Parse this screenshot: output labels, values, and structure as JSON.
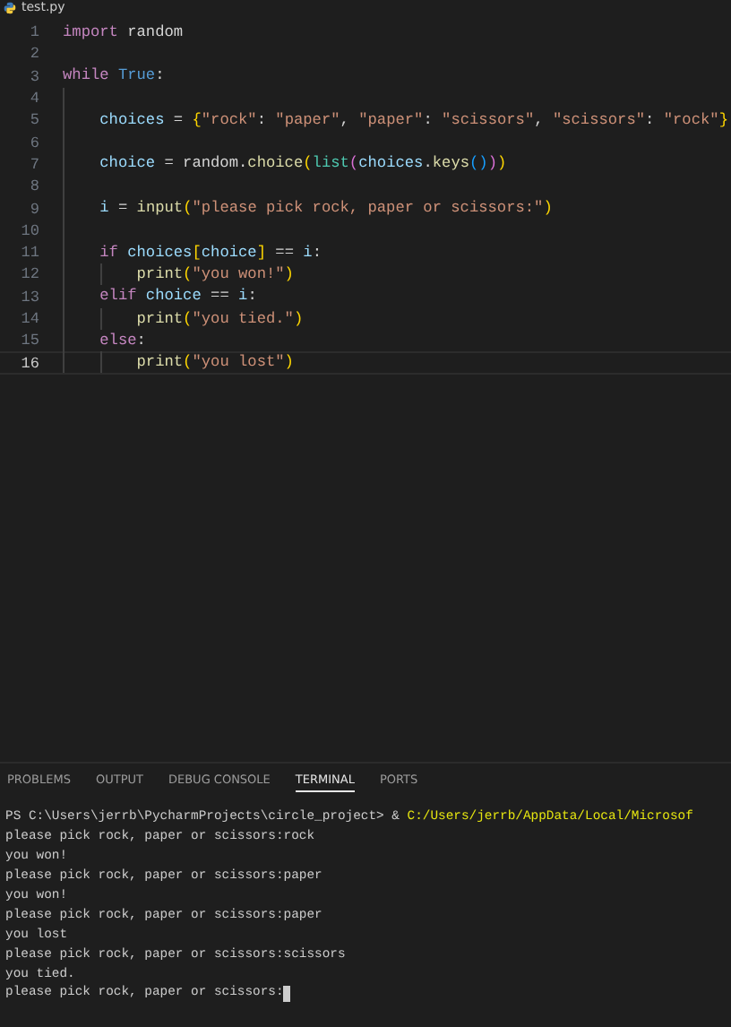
{
  "editor_tab": {
    "title": "test.py"
  },
  "code_lines": [
    {
      "number": "1",
      "kind": "code",
      "current": false,
      "tokens": [
        {
          "kind": "keyword",
          "text": "import"
        },
        {
          "kind": "plain",
          "text": " random"
        }
      ]
    },
    {
      "number": "2",
      "kind": "blank",
      "current": false
    },
    {
      "number": "3",
      "kind": "code",
      "current": false,
      "tokens": [
        {
          "kind": "keyword",
          "text": "while "
        },
        {
          "kind": "const",
          "text": "True"
        },
        {
          "kind": "plain",
          "text": ":"
        }
      ]
    },
    {
      "number": "4",
      "kind": "blank_indented",
      "current": false
    },
    {
      "number": "5",
      "kind": "code",
      "current": false,
      "tokens": [
        {
          "kind": "var",
          "text": "    choices"
        },
        {
          "kind": "plain",
          "text": " = "
        },
        {
          "kind": "bracket1",
          "text": "{"
        },
        {
          "kind": "string",
          "text": "\"rock\""
        },
        {
          "kind": "plain",
          "text": ": "
        },
        {
          "kind": "string",
          "text": "\"paper\""
        },
        {
          "kind": "plain",
          "text": ", "
        },
        {
          "kind": "string",
          "text": "\"paper\""
        },
        {
          "kind": "plain",
          "text": ": "
        },
        {
          "kind": "string",
          "text": "\"scissors\""
        },
        {
          "kind": "plain",
          "text": ", "
        },
        {
          "kind": "string",
          "text": "\"scissors\""
        },
        {
          "kind": "plain",
          "text": ": "
        },
        {
          "kind": "string",
          "text": "\"rock\""
        },
        {
          "kind": "bracket1",
          "text": "}"
        }
      ]
    },
    {
      "number": "6",
      "kind": "blank_indented",
      "current": false
    },
    {
      "number": "7",
      "kind": "code",
      "current": false,
      "tokens": [
        {
          "kind": "var",
          "text": "    choice"
        },
        {
          "kind": "plain",
          "text": " = random."
        },
        {
          "kind": "func",
          "text": "choice"
        },
        {
          "kind": "bracket1",
          "text": "("
        },
        {
          "kind": "type",
          "text": "list"
        },
        {
          "kind": "bracket2",
          "text": "("
        },
        {
          "kind": "var",
          "text": "choices"
        },
        {
          "kind": "plain",
          "text": "."
        },
        {
          "kind": "func",
          "text": "keys"
        },
        {
          "kind": "bracket3",
          "text": "()"
        },
        {
          "kind": "bracket2",
          "text": ")"
        },
        {
          "kind": "bracket1",
          "text": ")"
        }
      ]
    },
    {
      "number": "8",
      "kind": "blank_indented",
      "current": false
    },
    {
      "number": "9",
      "kind": "code",
      "current": false,
      "tokens": [
        {
          "kind": "var",
          "text": "    i"
        },
        {
          "kind": "plain",
          "text": " = "
        },
        {
          "kind": "func",
          "text": "input"
        },
        {
          "kind": "bracket1",
          "text": "("
        },
        {
          "kind": "string",
          "text": "\"please pick rock, paper or scissors:\""
        },
        {
          "kind": "bracket1",
          "text": ")"
        }
      ]
    },
    {
      "number": "10",
      "kind": "blank_indented",
      "current": false
    },
    {
      "number": "11",
      "kind": "code",
      "current": false,
      "tokens": [
        {
          "kind": "keyword",
          "text": "    if "
        },
        {
          "kind": "var",
          "text": "choices"
        },
        {
          "kind": "bracket1",
          "text": "["
        },
        {
          "kind": "var",
          "text": "choice"
        },
        {
          "kind": "bracket1",
          "text": "]"
        },
        {
          "kind": "plain",
          "text": " == "
        },
        {
          "kind": "var",
          "text": "i"
        },
        {
          "kind": "plain",
          "text": ":"
        }
      ]
    },
    {
      "number": "12",
      "kind": "code",
      "current": false,
      "tokens": [
        {
          "kind": "func",
          "text": "        print"
        },
        {
          "kind": "bracket1",
          "text": "("
        },
        {
          "kind": "string",
          "text": "\"you won!\""
        },
        {
          "kind": "bracket1",
          "text": ")"
        }
      ]
    },
    {
      "number": "13",
      "kind": "code",
      "current": false,
      "tokens": [
        {
          "kind": "keyword",
          "text": "    elif "
        },
        {
          "kind": "var",
          "text": "choice"
        },
        {
          "kind": "plain",
          "text": " == "
        },
        {
          "kind": "var",
          "text": "i"
        },
        {
          "kind": "plain",
          "text": ":"
        }
      ]
    },
    {
      "number": "14",
      "kind": "code",
      "current": false,
      "tokens": [
        {
          "kind": "func",
          "text": "        print"
        },
        {
          "kind": "bracket1",
          "text": "("
        },
        {
          "kind": "string",
          "text": "\"you tied.\""
        },
        {
          "kind": "bracket1",
          "text": ")"
        }
      ]
    },
    {
      "number": "15",
      "kind": "code",
      "current": false,
      "tokens": [
        {
          "kind": "keyword",
          "text": "    else"
        },
        {
          "kind": "plain",
          "text": ":"
        }
      ]
    },
    {
      "number": "16",
      "kind": "code",
      "current": true,
      "tokens": [
        {
          "kind": "func",
          "text": "        print"
        },
        {
          "kind": "bracket1",
          "text": "("
        },
        {
          "kind": "string",
          "text": "\"you lost\""
        },
        {
          "kind": "bracket1",
          "text": ")"
        }
      ]
    }
  ],
  "panel_tabs": [
    {
      "label": "PROBLEMS",
      "selected": false
    },
    {
      "label": "OUTPUT",
      "selected": false
    },
    {
      "label": "DEBUG CONSOLE",
      "selected": false
    },
    {
      "label": "TERMINAL",
      "selected": true
    },
    {
      "label": "PORTS",
      "selected": false
    }
  ],
  "terminal_lines": [
    {
      "cursor": false,
      "segments": [
        {
          "kind": "plain",
          "text": "PS C:\\Users\\jerrb\\PycharmProjects\\circle_project> & "
        },
        {
          "kind": "path",
          "text": "C:/Users/jerrb/AppData/Local/Microsof"
        }
      ]
    },
    {
      "cursor": false,
      "segments": [
        {
          "kind": "plain",
          "text": "please pick rock, paper or scissors:rock"
        }
      ]
    },
    {
      "cursor": false,
      "segments": [
        {
          "kind": "plain",
          "text": "you won!"
        }
      ]
    },
    {
      "cursor": false,
      "segments": [
        {
          "kind": "plain",
          "text": "please pick rock, paper or scissors:paper"
        }
      ]
    },
    {
      "cursor": false,
      "segments": [
        {
          "kind": "plain",
          "text": "you won!"
        }
      ]
    },
    {
      "cursor": false,
      "segments": [
        {
          "kind": "plain",
          "text": "please pick rock, paper or scissors:paper"
        }
      ]
    },
    {
      "cursor": false,
      "segments": [
        {
          "kind": "plain",
          "text": "you lost"
        }
      ]
    },
    {
      "cursor": false,
      "segments": [
        {
          "kind": "plain",
          "text": "please pick rock, paper or scissors:scissors"
        }
      ]
    },
    {
      "cursor": false,
      "segments": [
        {
          "kind": "plain",
          "text": "you tied."
        }
      ]
    },
    {
      "cursor": true,
      "segments": [
        {
          "kind": "plain",
          "text": "please pick rock, paper or scissors:"
        }
      ]
    }
  ]
}
